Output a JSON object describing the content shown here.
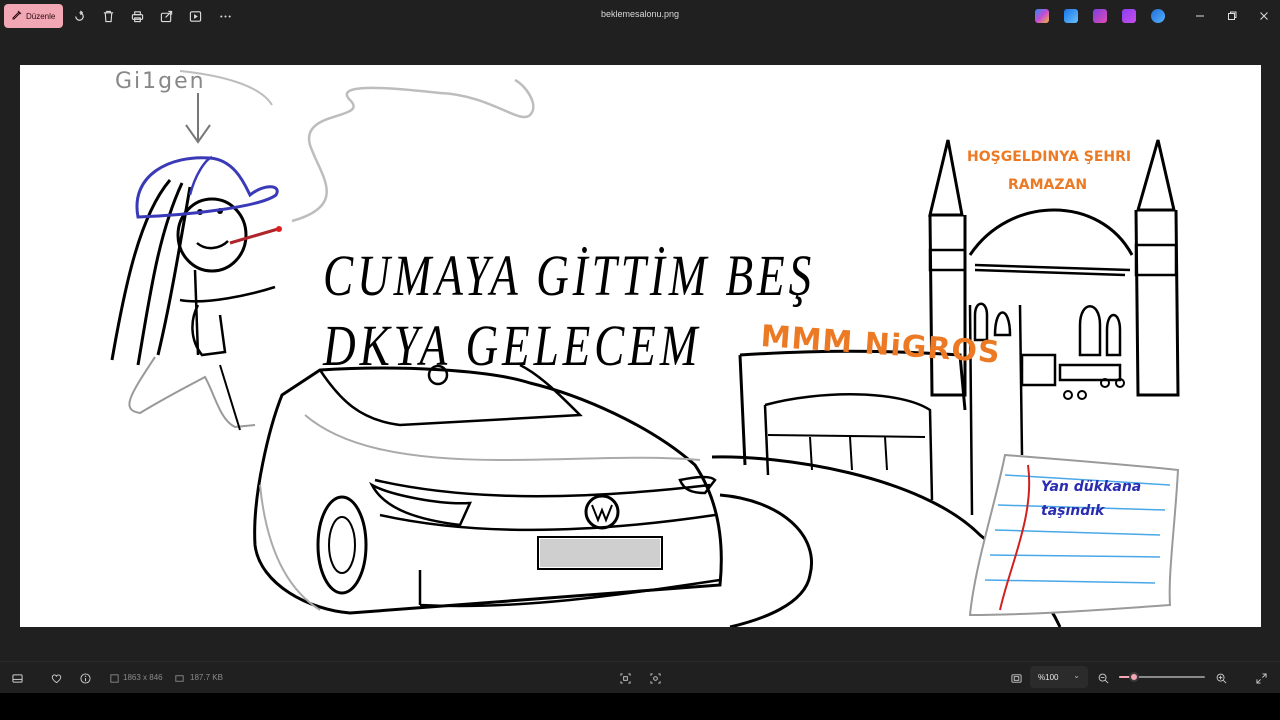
{
  "toolbar": {
    "edit_label": "Düzenle",
    "icons": [
      "rotate-icon",
      "delete-icon",
      "print-icon",
      "share-icon",
      "slideshow-icon",
      "more-icon"
    ]
  },
  "window": {
    "title": "beklemesalonu.png",
    "controls": [
      "minimize-icon",
      "restore-icon",
      "close-icon"
    ],
    "app_icons": [
      "copilot-icon",
      "photoshop-express-icon",
      "clipchamp-icon",
      "designer-icon",
      "onedrive-icon"
    ]
  },
  "image": {
    "headline_line1": "CUMAYA GİTTİM BEŞ",
    "headline_line2": "DKYA GELECEM",
    "scribble_name": "Gi1gen",
    "migros_label": "MMM NiGROS",
    "mosque_sign_line1": "HOŞGELDINYA ŞEHRI",
    "mosque_sign_line2": "RAMAZAN",
    "note_line1": "Yan dükkana",
    "note_line2": "taşındık"
  },
  "statusbar": {
    "dimensions": "1863 x 846",
    "file_size": "187.7 KB",
    "zoom": "%100",
    "zoom_level_fraction": 0.18
  },
  "colors": {
    "accent": "#f2a7b4",
    "background": "#202020",
    "orange": "#ec7a24",
    "note_blue": "#2b2db0",
    "cap_blue": "#3a3ab8"
  }
}
